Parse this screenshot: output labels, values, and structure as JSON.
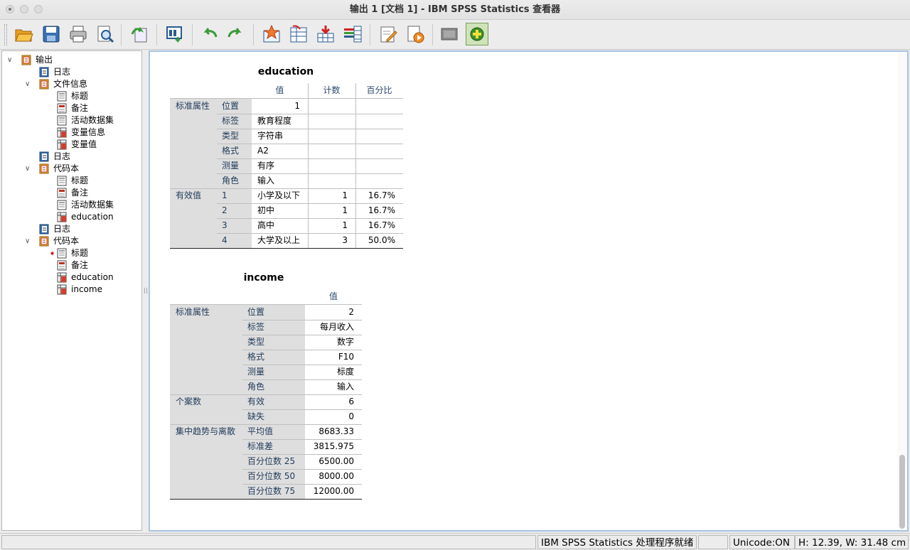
{
  "window": {
    "title": "输出 1 [文档 1] - IBM SPSS Statistics 查看器"
  },
  "toolbar": {
    "buttons": [
      {
        "name": "open"
      },
      {
        "name": "save"
      },
      {
        "name": "print"
      },
      {
        "name": "print-preview"
      },
      {
        "name": "export"
      },
      {
        "name": "recall-dialog"
      },
      {
        "name": "undo"
      },
      {
        "name": "redo"
      },
      {
        "name": "goto-data"
      },
      {
        "name": "goto-case"
      },
      {
        "name": "insert-output"
      },
      {
        "name": "variables"
      },
      {
        "name": "edit"
      },
      {
        "name": "script"
      },
      {
        "name": "hide"
      },
      {
        "name": "designate-window"
      }
    ]
  },
  "tree": {
    "items": [
      {
        "label": "输出",
        "level": 0,
        "expanded": true,
        "icon": "book-icon"
      },
      {
        "label": "日志",
        "level": 1,
        "icon": "log-icon"
      },
      {
        "label": "文件信息",
        "level": 1,
        "expanded": true,
        "icon": "book-icon"
      },
      {
        "label": "标题",
        "level": 2,
        "icon": "title-icon"
      },
      {
        "label": "备注",
        "level": 2,
        "icon": "notes-icon"
      },
      {
        "label": "活动数据集",
        "level": 2,
        "icon": "title-icon"
      },
      {
        "label": "变量信息",
        "level": 2,
        "icon": "table-icon"
      },
      {
        "label": "变量值",
        "level": 2,
        "icon": "table-icon"
      },
      {
        "label": "日志",
        "level": 1,
        "icon": "log-icon"
      },
      {
        "label": "代码本",
        "level": 1,
        "expanded": true,
        "icon": "book-icon"
      },
      {
        "label": "标题",
        "level": 2,
        "icon": "title-icon"
      },
      {
        "label": "备注",
        "level": 2,
        "icon": "notes-icon"
      },
      {
        "label": "活动数据集",
        "level": 2,
        "icon": "title-icon"
      },
      {
        "label": "education",
        "level": 2,
        "icon": "table-icon"
      },
      {
        "label": "日志",
        "level": 1,
        "icon": "log-icon"
      },
      {
        "label": "代码本",
        "level": 1,
        "expanded": true,
        "icon": "book-icon"
      },
      {
        "label": "标题",
        "level": 2,
        "icon": "title-icon",
        "current": true
      },
      {
        "label": "备注",
        "level": 2,
        "icon": "notes-icon"
      },
      {
        "label": "education",
        "level": 2,
        "icon": "table-icon"
      },
      {
        "label": "income",
        "level": 2,
        "icon": "table-icon"
      }
    ]
  },
  "education_table": {
    "title": "education",
    "columns": [
      "值",
      "计数",
      "百分比"
    ],
    "groups": [
      {
        "label": "标准属性",
        "rows": [
          {
            "sub": "位置",
            "value": "1",
            "count": "",
            "percent": ""
          },
          {
            "sub": "标签",
            "value": "教育程度",
            "count": "",
            "percent": ""
          },
          {
            "sub": "类型",
            "value": "字符串",
            "count": "",
            "percent": ""
          },
          {
            "sub": "格式",
            "value": "A2",
            "count": "",
            "percent": ""
          },
          {
            "sub": "测量",
            "value": "有序",
            "count": "",
            "percent": ""
          },
          {
            "sub": "角色",
            "value": "输入",
            "count": "",
            "percent": ""
          }
        ]
      },
      {
        "label": "有效值",
        "rows": [
          {
            "sub": "1",
            "value": "小学及以下",
            "count": "1",
            "percent": "16.7%"
          },
          {
            "sub": "2",
            "value": "初中",
            "count": "1",
            "percent": "16.7%"
          },
          {
            "sub": "3",
            "value": "高中",
            "count": "1",
            "percent": "16.7%"
          },
          {
            "sub": "4",
            "value": "大学及以上",
            "count": "3",
            "percent": "50.0%"
          }
        ]
      }
    ]
  },
  "income_table": {
    "title": "income",
    "columns": [
      "值"
    ],
    "groups": [
      {
        "label": "标准属性",
        "rows": [
          {
            "sub": "位置",
            "value": "2"
          },
          {
            "sub": "标签",
            "value": "每月收入"
          },
          {
            "sub": "类型",
            "value": "数字"
          },
          {
            "sub": "格式",
            "value": "F10"
          },
          {
            "sub": "测量",
            "value": "标度"
          },
          {
            "sub": "角色",
            "value": "输入"
          }
        ]
      },
      {
        "label": "个案数",
        "rows": [
          {
            "sub": "有效",
            "value": "6"
          },
          {
            "sub": "缺失",
            "value": "0"
          }
        ]
      },
      {
        "label": "集中趋势与离散",
        "rows": [
          {
            "sub": "平均值",
            "value": "8683.33"
          },
          {
            "sub": "标准差",
            "value": "3815.975"
          },
          {
            "sub": "百分位数 25",
            "value": "6500.00"
          },
          {
            "sub": "百分位数 50",
            "value": "8000.00"
          },
          {
            "sub": "百分位数 75",
            "value": "12000.00"
          }
        ]
      }
    ]
  },
  "status": {
    "processor": "IBM SPSS Statistics 处理程序就绪",
    "unicode": "Unicode:ON",
    "size": "H: 12.39, W: 31.48 cm"
  }
}
